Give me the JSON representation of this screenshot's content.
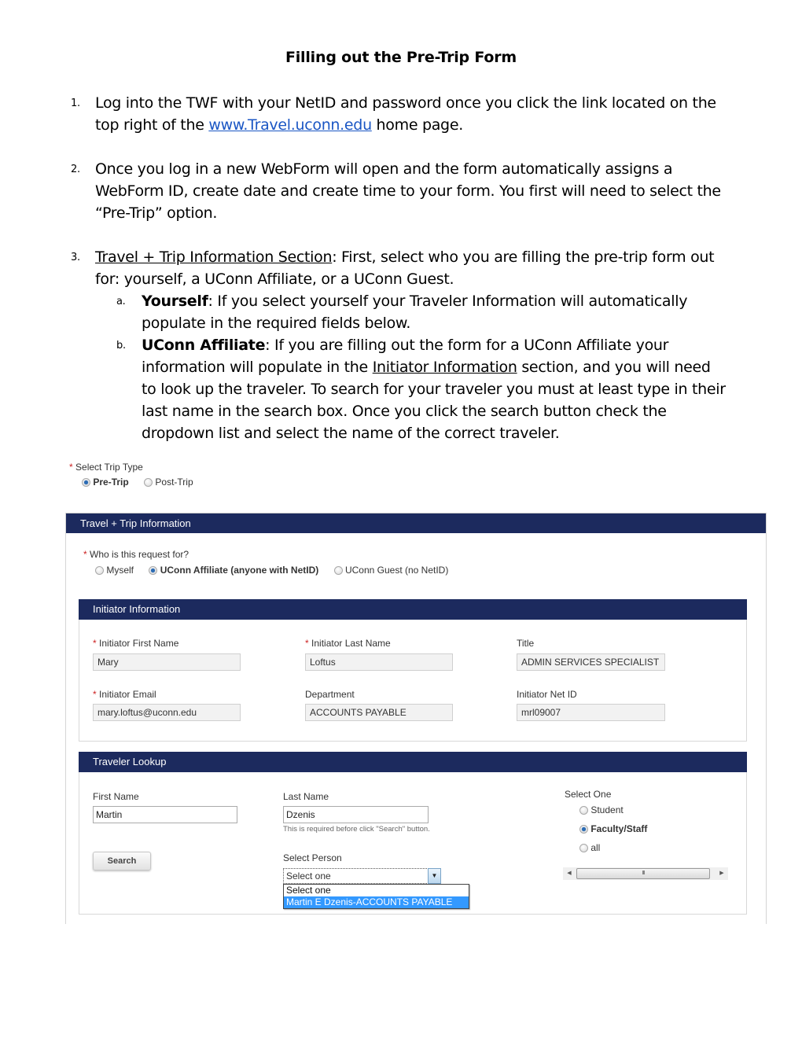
{
  "document": {
    "title": "Filling out the Pre-Trip Form",
    "steps": [
      {
        "number": "1.",
        "line1": "Log into the TWF with your NetID and password once you click the link located on the",
        "line2_before": "top right of the ",
        "link_text": "www.Travel.uconn.edu",
        "line2_after": " home page."
      },
      {
        "number": "2.",
        "line1": "Once you log in a new WebForm will open and the form automatically assigns a",
        "line2": "WebForm ID, create date and create time to your form. You first will need to select the",
        "line3": "“Pre-Trip” option."
      },
      {
        "number": "3.",
        "heading": "Travel + Trip Information Section",
        "line1_rest": ": First, select who you are filling the pre-trip form out",
        "line2": "for: yourself, a UConn Affiliate, or a UConn Guest.",
        "substeps": [
          {
            "letter": "a.",
            "bold": "Yourself",
            "line1_rest": ": If you select yourself your Traveler Information will automatically",
            "line2": "populate in the required fields below."
          },
          {
            "letter": "b.",
            "bold": "UConn Affiliate",
            "line1_rest": ": If you are filling out the form for a UConn Affiliate your",
            "line2_before": "information will populate in the ",
            "line2_underlined": "Initiator Information",
            "line2_after": " section, and you will need",
            "line3": "to look up the traveler. To search for your traveler you must at least type in their",
            "line4": "last name in the search box. Once you click the search button check the",
            "line5": "dropdown list and select the name of the correct traveler."
          }
        ]
      }
    ]
  },
  "form": {
    "required_marker": "*",
    "trip_type": {
      "label": "Select Trip Type",
      "options": [
        {
          "label": "Pre-Trip",
          "selected": true
        },
        {
          "label": "Post-Trip",
          "selected": false
        }
      ]
    },
    "travel_section": {
      "header": "Travel + Trip Information",
      "who_label": "Who is this request for?",
      "who_options": [
        {
          "label": "Myself",
          "selected": false
        },
        {
          "label": "UConn Affiliate (anyone with NetID)",
          "selected": true
        },
        {
          "label": "UConn Guest (no NetID)",
          "selected": false
        }
      ]
    },
    "initiator": {
      "header": "Initiator Information",
      "fields": {
        "first_name": {
          "label": "Initiator First Name",
          "value": "Mary",
          "required": true
        },
        "last_name": {
          "label": "Initiator Last Name",
          "value": "Loftus",
          "required": true
        },
        "title": {
          "label": "Title",
          "value": "ADMIN SERVICES SPECIALIST",
          "required": false
        },
        "email": {
          "label": "Initiator Email",
          "value": "mary.loftus@uconn.edu",
          "required": true
        },
        "department": {
          "label": "Department",
          "value": "ACCOUNTS PAYABLE",
          "required": false
        },
        "net_id": {
          "label": "Initiator Net ID",
          "value": "mrl09007",
          "required": false
        }
      }
    },
    "traveler_lookup": {
      "header": "Traveler Lookup",
      "first_name": {
        "label": "First Name",
        "value": "Martin"
      },
      "last_name": {
        "label": "Last Name",
        "value": "Dzenis",
        "hint": "This is required before click \"Search\" button."
      },
      "search_button": "Search",
      "select_person": {
        "label": "Select Person",
        "selected": "Select one",
        "options": [
          "Select one",
          "Martin E Dzenis-ACCOUNTS PAYABLE"
        ],
        "highlighted_index": 1
      },
      "select_one": {
        "label": "Select One",
        "options": [
          {
            "label": "Student",
            "selected": false
          },
          {
            "label": "Faculty/Staff",
            "selected": true
          },
          {
            "label": "all",
            "selected": false
          }
        ]
      },
      "scrollbar_grip": "III"
    }
  }
}
